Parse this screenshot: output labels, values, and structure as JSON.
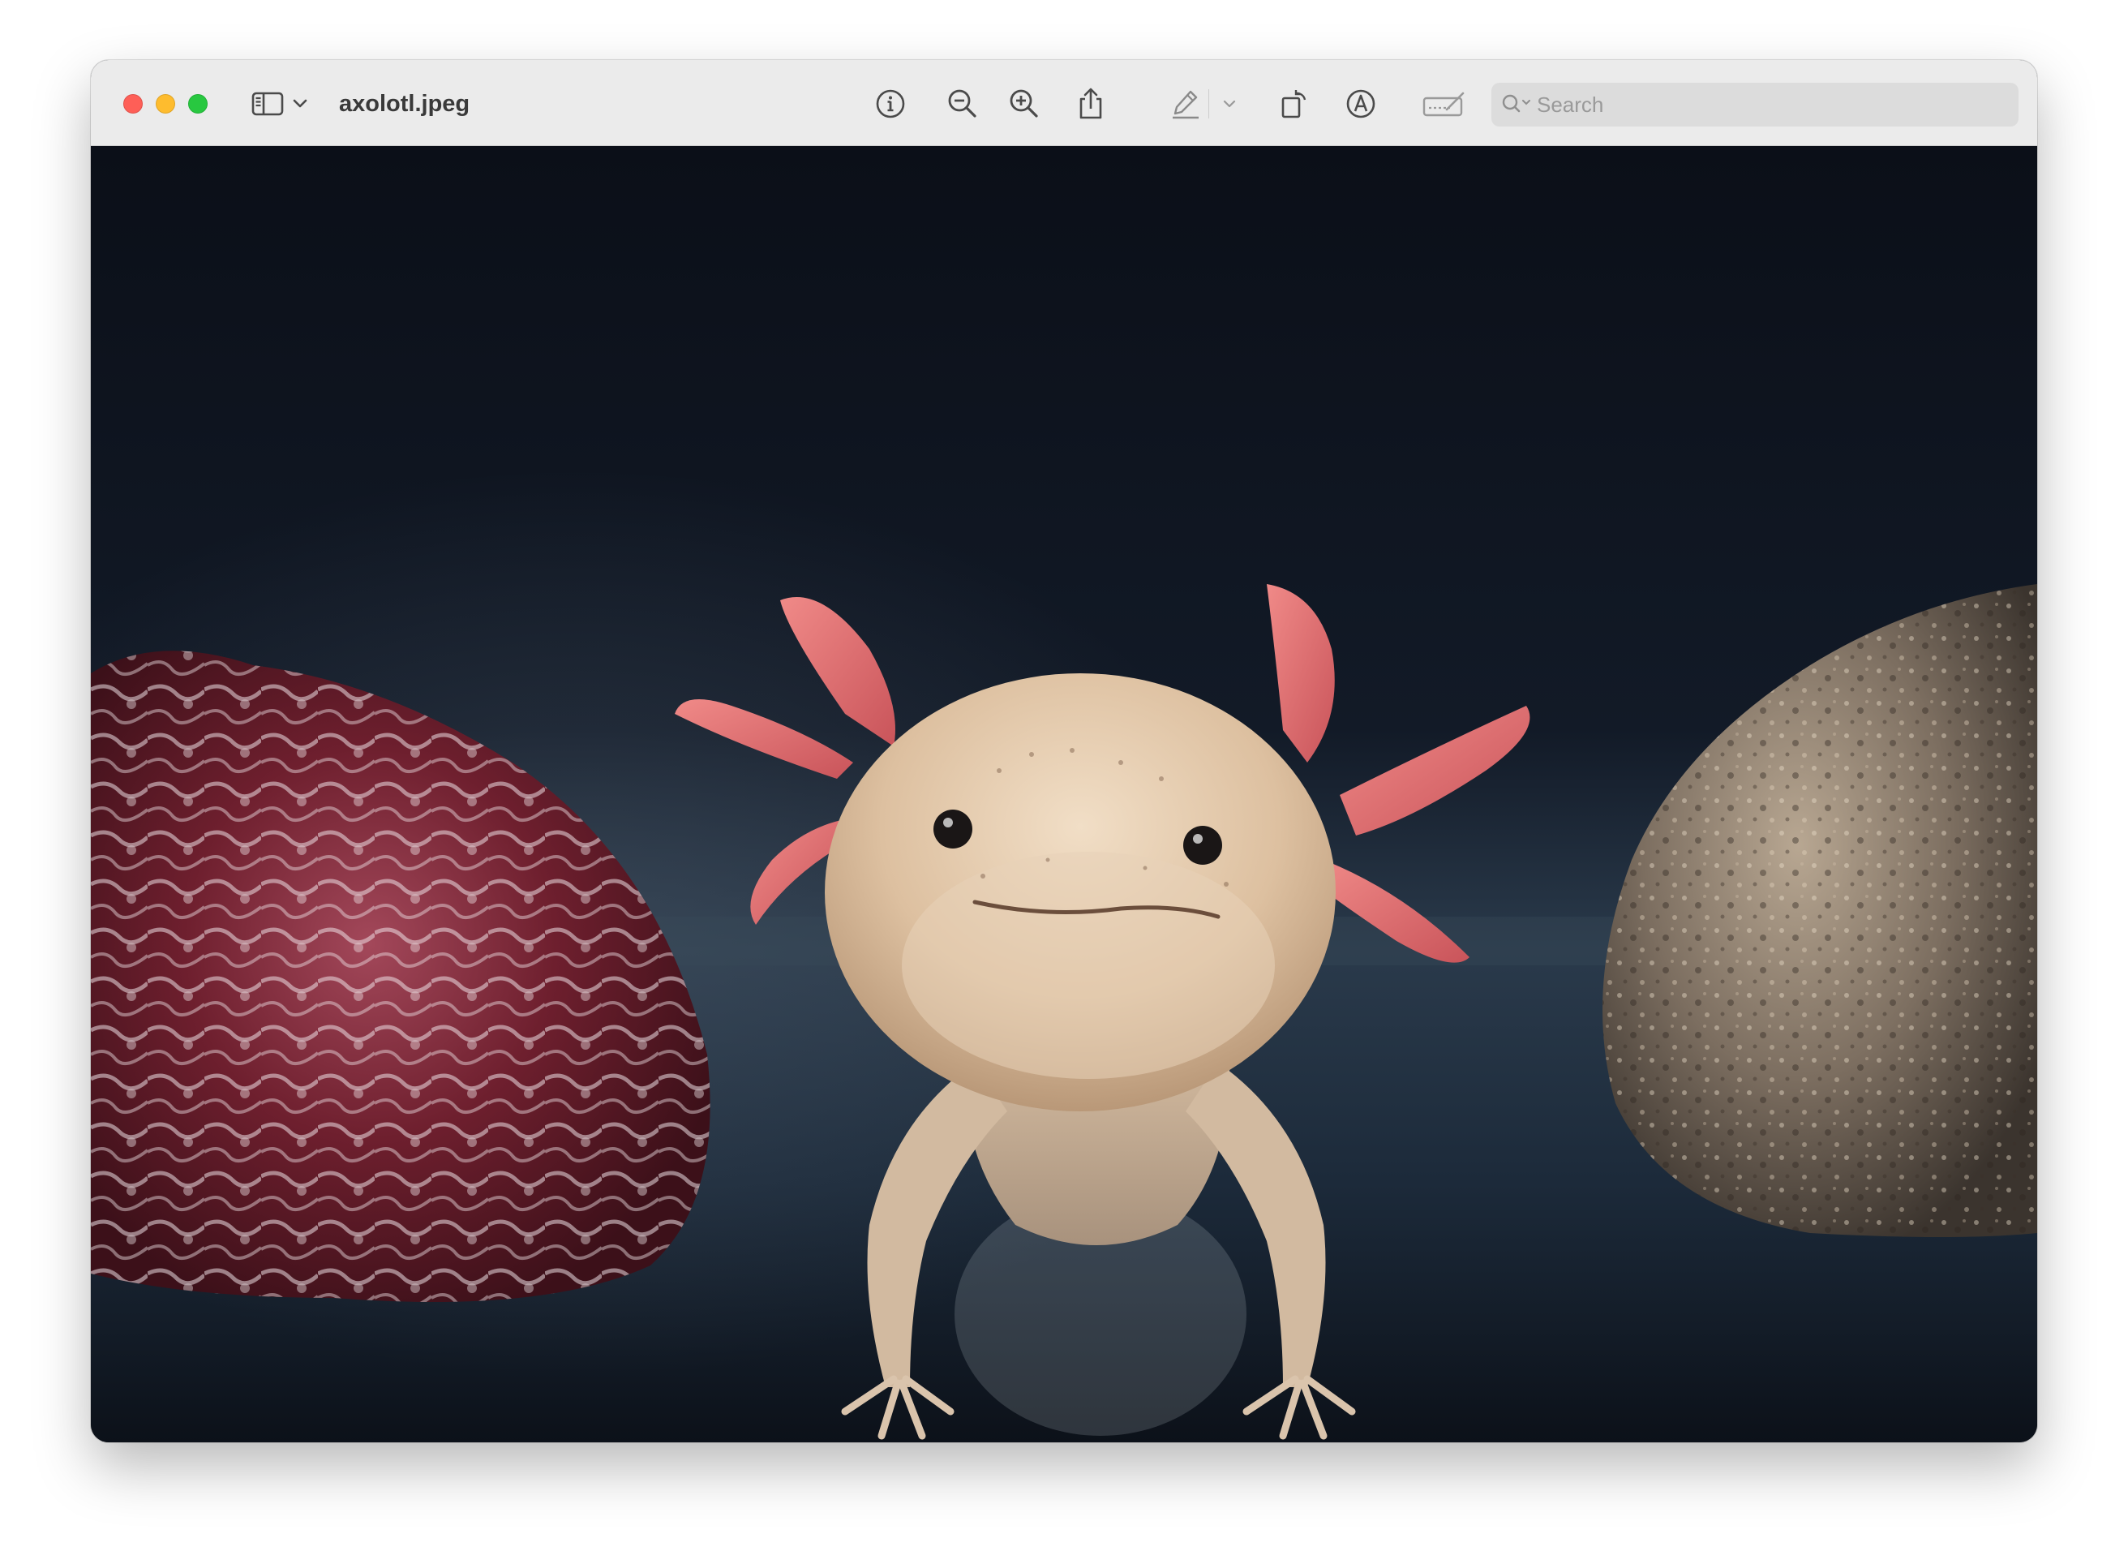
{
  "window": {
    "title": "axolotl.jpeg"
  },
  "toolbar": {
    "icons": {
      "sidebar": "sidebar-icon",
      "sidebar_menu": "chevron-down-icon",
      "info": "info-icon",
      "zoom_out": "zoom-out-icon",
      "zoom_in": "zoom-in-icon",
      "share": "share-icon",
      "markup": "pen-icon",
      "markup_menu": "chevron-down-icon",
      "rotate": "rotate-icon",
      "annotate": "markup-circle-icon",
      "signature": "signature-icon"
    }
  },
  "search": {
    "placeholder": "Search"
  },
  "colors": {
    "titlebar": "#ebebeb",
    "close": "#fe5f57",
    "minimize": "#febc2e",
    "maximize": "#28c840",
    "photo_background": "#0d121b"
  }
}
